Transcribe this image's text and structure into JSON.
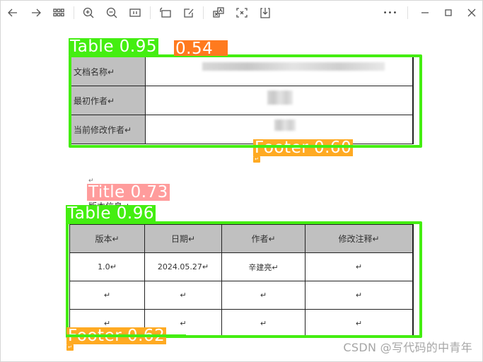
{
  "toolbar": {
    "left_icons": [
      {
        "name": "back-icon",
        "glyph": "←"
      },
      {
        "name": "forward-icon",
        "glyph": "→"
      },
      {
        "name": "grid-view-icon",
        "glyph": "⊞"
      },
      {
        "name": "zoom-in-icon",
        "glyph": "⊕"
      },
      {
        "name": "zoom-out-icon",
        "glyph": "⊖"
      },
      {
        "name": "actual-size-icon",
        "glyph": "1:1"
      },
      {
        "name": "rotate-icon",
        "glyph": "⟲"
      },
      {
        "name": "edit-icon",
        "glyph": "✎"
      },
      {
        "name": "translate-icon",
        "glyph": "A"
      },
      {
        "name": "extract-text-icon",
        "glyph": "x"
      },
      {
        "name": "save-icon",
        "glyph": "⤓"
      }
    ],
    "actual_size_label": "1:1",
    "more_label": "•••",
    "window_controls": {
      "minimize": "—",
      "maximize": "☐",
      "close": "✕"
    }
  },
  "detections": [
    {
      "label": "Table 0.95",
      "color": "#44ee11"
    },
    {
      "label": "0.54",
      "color": "#ff7a1e"
    },
    {
      "label": "Footer 0.60",
      "color": "#ffaa22"
    },
    {
      "label": "Title 0.73",
      "color": "#ff9c9c"
    },
    {
      "label": "Table 0.96",
      "color": "#44ee11"
    },
    {
      "label": "Footer 0.62",
      "color": "#ffaa22"
    }
  ],
  "doc_info_table": {
    "rows": [
      {
        "label": "文档名称↵"
      },
      {
        "label": "最初作者↵"
      },
      {
        "label": "当前修改作者↵"
      }
    ]
  },
  "section_title": "版本信息↵",
  "version_table": {
    "headers": [
      "版本↵",
      "日期↵",
      "作者↵",
      "修改注释↵"
    ],
    "rows": [
      [
        "1.0↵",
        "2024.05.27↵",
        "辛建亮↵",
        "↵"
      ],
      [
        "↵",
        "↵",
        "↵",
        "↵"
      ],
      [
        "↵",
        "↵",
        "↵",
        "↵"
      ]
    ]
  },
  "paragraph_mark": "↵",
  "watermark": "CSDN @写代码的中青年"
}
